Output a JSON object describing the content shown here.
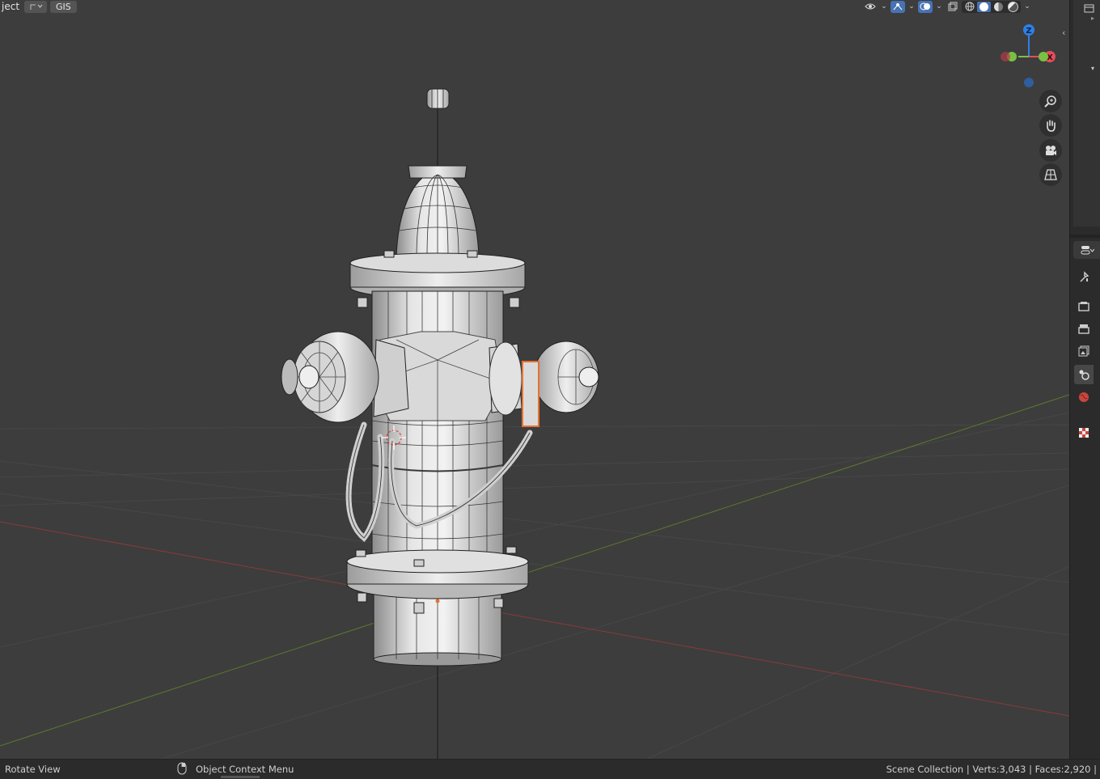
{
  "header": {
    "mode_label": "ject",
    "addon_label": "GIS"
  },
  "gizmo": {
    "z_label": "Z",
    "x_label": "X",
    "z_color": "#2e80e6",
    "x_color": "#e84c5c",
    "y_color": "#7ac043"
  },
  "status": {
    "left_action": "Rotate View",
    "middle_action": "Object Context Menu",
    "stats": "Scene Collection | Verts:3,043 | Faces:2,920 |"
  },
  "colors": {
    "viewport_bg": "#3d3d3d",
    "accent": "#4772b3",
    "selection": "#e8712f",
    "axis_x": "#8a3a3a",
    "axis_y": "#5c7a2d"
  }
}
